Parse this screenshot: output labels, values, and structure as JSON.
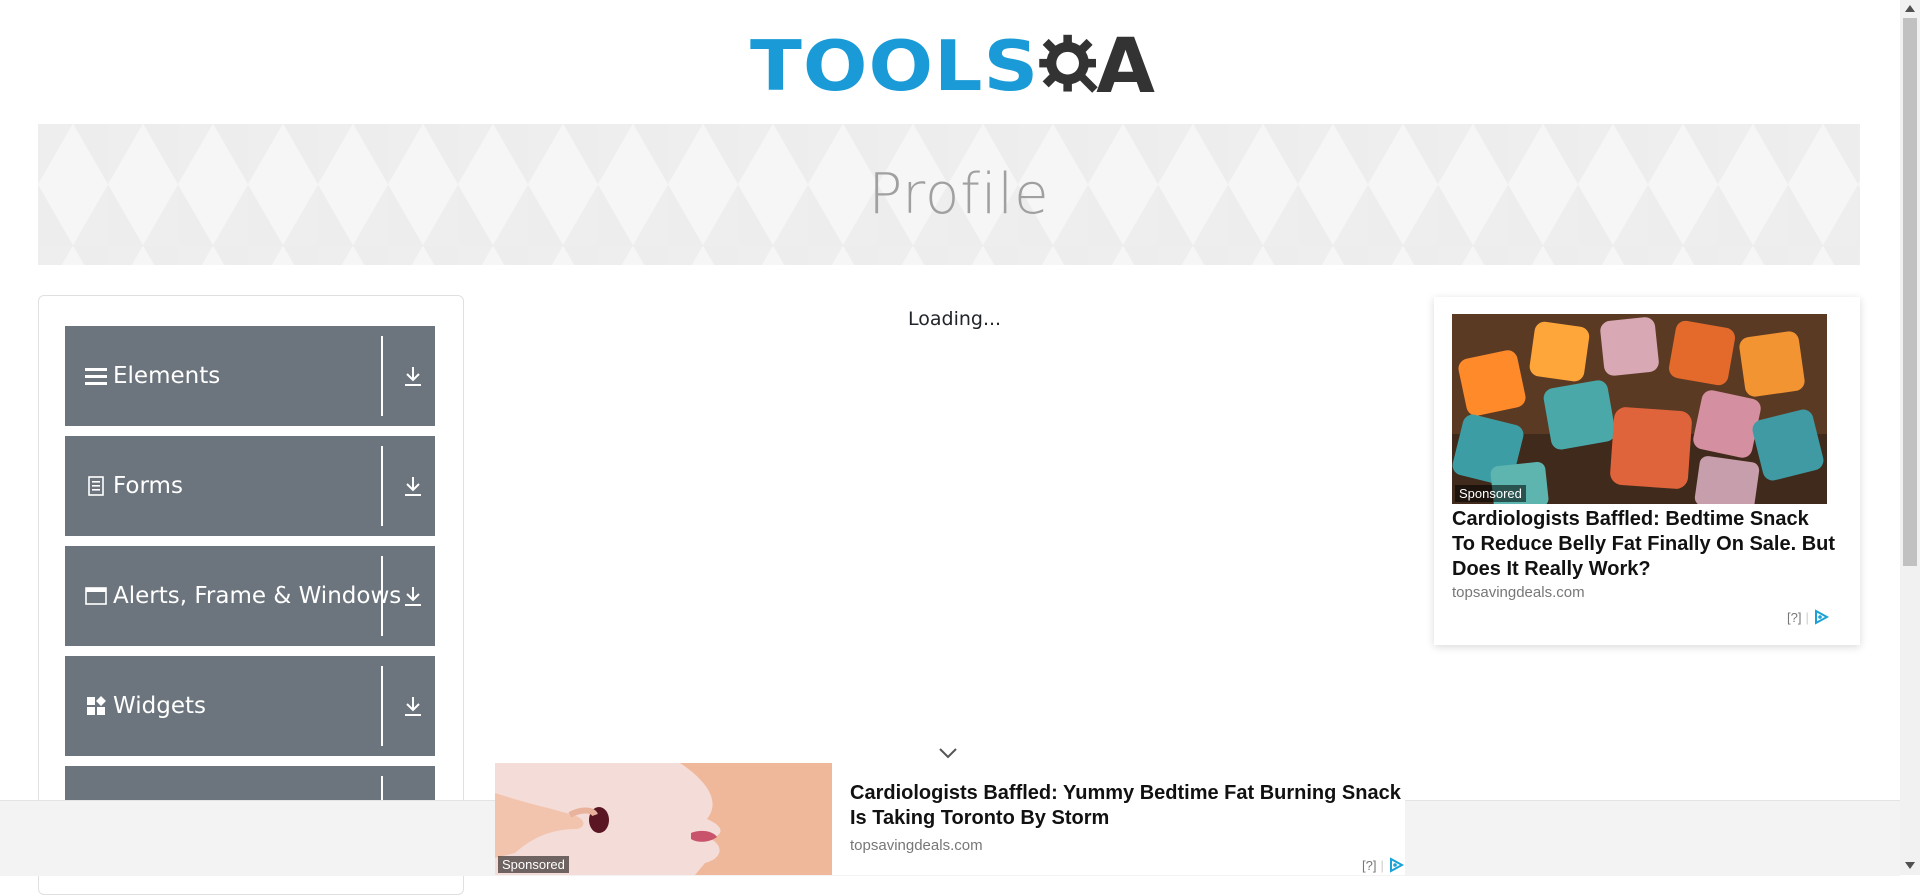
{
  "header": {
    "logo_text_tools": "TOOLS",
    "logo_text_a": "A"
  },
  "banner": {
    "title": "Profile"
  },
  "sidebar": {
    "items": [
      {
        "label": "Elements",
        "icon": "hamburger-icon"
      },
      {
        "label": "Forms",
        "icon": "document-icon"
      },
      {
        "label": "Alerts, Frame & Windows",
        "icon": "window-icon"
      },
      {
        "label": "Widgets",
        "icon": "widgets-icon"
      },
      {
        "label": "",
        "icon": ""
      }
    ]
  },
  "main": {
    "loading_text": "Loading..."
  },
  "ad_right": {
    "sponsored": "Sponsored",
    "headline": "Cardiologists Baffled: Bedtime Snack To Reduce Belly Fat Finally On Sale. But Does It Really Work?",
    "domain": "topsavingdeals.com",
    "help": "[?]"
  },
  "ad_bottom": {
    "sponsored": "Sponsored",
    "headline": "Cardiologists Baffled: Yummy Bedtime Fat Burning Snack Is Taking Toronto By Storm",
    "domain": "topsavingdeals.com",
    "help": "[?]"
  },
  "colors": {
    "brand_blue": "#1a9bd7",
    "brand_dark": "#333333",
    "menu_bg": "#6c757d",
    "banner_text": "#a0a0a0"
  }
}
